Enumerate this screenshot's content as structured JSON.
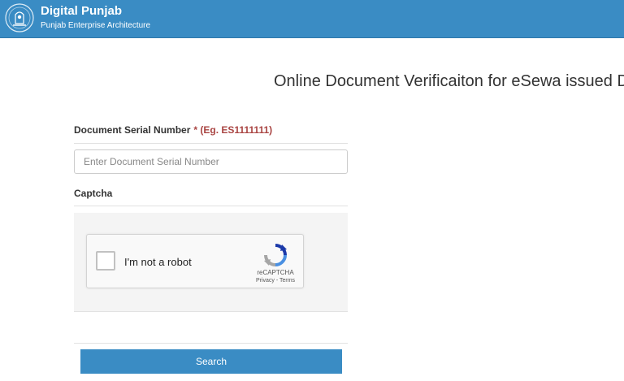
{
  "header": {
    "title": "Digital Punjab",
    "subtitle": "Punjab Enterprise Architecture",
    "emblem_icon": "state-emblem-icon",
    "background_color": "#3a8cc4"
  },
  "page": {
    "heading": "Online Document Verificaiton for eSewa issued Do"
  },
  "form": {
    "serial_label": "Document Serial Number",
    "serial_hint": "* (Eg. ES1111111)",
    "serial_placeholder": "Enter Document Serial Number",
    "serial_value": "",
    "captcha_label": "Captcha",
    "search_label": "Search"
  },
  "recaptcha": {
    "checkbox_label": "I'm not a robot",
    "brand": "reCAPTCHA",
    "privacy_link": "Privacy",
    "separator": " - ",
    "terms_link": "Terms",
    "logo_icon": "recaptcha-logo-icon"
  }
}
